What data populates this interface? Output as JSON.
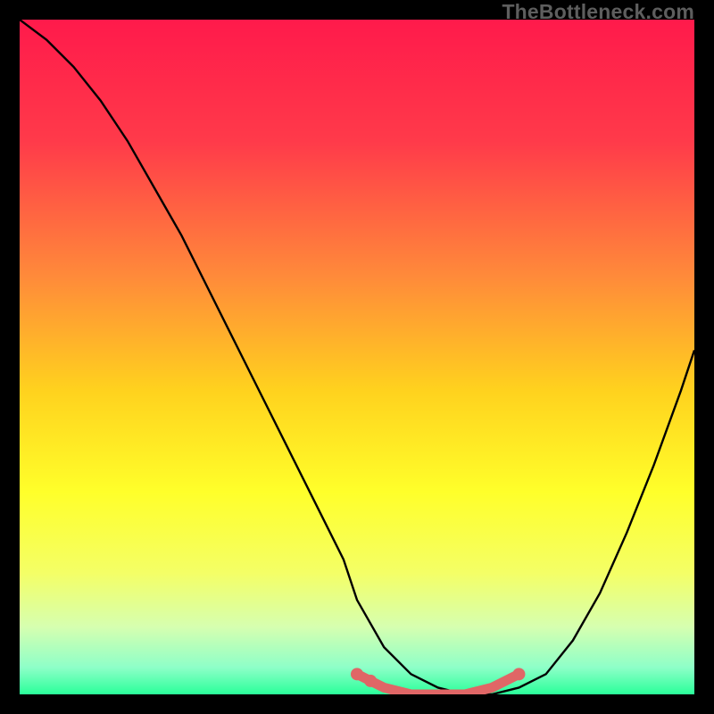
{
  "watermark": "TheBottleneck.com",
  "chart_data": {
    "type": "line",
    "title": "",
    "xlabel": "",
    "ylabel": "",
    "xlim": [
      0,
      100
    ],
    "ylim": [
      0,
      100
    ],
    "gradient_stops": [
      {
        "offset": 0,
        "color": "#ff1a4b"
      },
      {
        "offset": 18,
        "color": "#ff3a4a"
      },
      {
        "offset": 38,
        "color": "#ff8a3a"
      },
      {
        "offset": 55,
        "color": "#ffd21e"
      },
      {
        "offset": 70,
        "color": "#ffff2a"
      },
      {
        "offset": 82,
        "color": "#f4ff66"
      },
      {
        "offset": 90,
        "color": "#d6ffb0"
      },
      {
        "offset": 96,
        "color": "#8effc8"
      },
      {
        "offset": 100,
        "color": "#2aff9a"
      }
    ],
    "series": [
      {
        "name": "bottleneck-curve",
        "stroke": "#000000",
        "x": [
          0,
          4,
          8,
          12,
          16,
          20,
          24,
          28,
          32,
          36,
          40,
          44,
          48,
          50,
          54,
          58,
          62,
          66,
          70,
          74,
          78,
          82,
          86,
          90,
          94,
          98,
          100
        ],
        "y": [
          100,
          97,
          93,
          88,
          82,
          75,
          68,
          60,
          52,
          44,
          36,
          28,
          20,
          14,
          7,
          3,
          1,
          0,
          0,
          1,
          3,
          8,
          15,
          24,
          34,
          45,
          51
        ]
      },
      {
        "name": "highlight-band",
        "stroke": "#e06666",
        "x": [
          50,
          54,
          58,
          62,
          66,
          70,
          74
        ],
        "y": [
          3,
          1,
          0,
          0,
          0,
          1,
          3
        ]
      }
    ],
    "highlight_dots": {
      "stroke": "#e06666",
      "points": [
        {
          "x": 50,
          "y": 3
        },
        {
          "x": 52,
          "y": 2
        },
        {
          "x": 74,
          "y": 3
        }
      ]
    }
  }
}
